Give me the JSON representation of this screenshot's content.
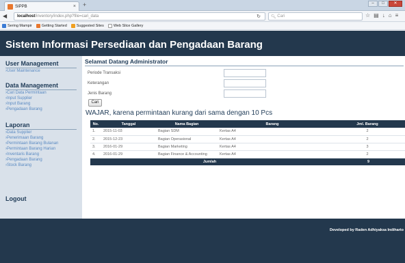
{
  "browser": {
    "tab_title": "SIPPB",
    "tab_close": "×",
    "new_tab": "+",
    "win_min": "–",
    "win_max": "□",
    "win_close": "✕",
    "url_host": "localhost",
    "url_path": "/inventory/index.php?file=cari_data",
    "search_placeholder": "Cari",
    "bookmarks": [
      {
        "label": "Sering Mampir",
        "color": "#3a7bd5"
      },
      {
        "label": "Getting Started",
        "color": "#e8772e"
      },
      {
        "label": "Suggested Sites",
        "color": "#f0a020"
      },
      {
        "label": "Web Slice Gallery",
        "color": "#ffffff"
      }
    ]
  },
  "header": {
    "title": "Sistem Informasi Persediaan dan Pengadaan Barang"
  },
  "sidebar": {
    "user_management": {
      "heading": "User Management",
      "links": [
        "User Maintenance"
      ]
    },
    "data_management": {
      "heading": "Data Management",
      "links": [
        "Cari Data Permintaan",
        "Input Supplier",
        "Input Barang",
        "Pengadaan Barang"
      ]
    },
    "laporan": {
      "heading": "Laporan",
      "links": [
        "Data Supplier",
        "Penerimaan Barang",
        "Permintaan Barang Bulanan",
        "Permintaan Barang Harian",
        "Inventaris Barang",
        "Pengadaan Barang",
        "Stock Barang"
      ]
    },
    "logout": "Logout"
  },
  "main": {
    "welcome": "Selamat Datang Administrator",
    "form": {
      "periode_label": "Periode Transaksi",
      "keterangan_label": "Keterangan",
      "jenis_label": "Jenis Barang",
      "periode_value": "",
      "keterangan_value": "",
      "jenis_value": "",
      "button": "Cari"
    },
    "notice": "WAJAR, karena permintaan kurang dari sama dengan 10 Pcs",
    "table": {
      "headers": [
        "No.",
        "Tanggal",
        "Nama Bagian",
        "Barang",
        "Jml. Barang"
      ],
      "rows": [
        [
          "1.",
          "2015-11-03",
          "Bagian SDM",
          "Kertas A4",
          "2"
        ],
        [
          "2.",
          "2015-12-23",
          "Bagian Operasional",
          "Kertas A4",
          "2"
        ],
        [
          "3.",
          "2016-01-29",
          "Bagian Marketing",
          "Kertas A4",
          "3"
        ],
        [
          "4.",
          "2016-01-29",
          "Bagian Finance & Accounting",
          "Kertas A4",
          "2"
        ]
      ],
      "footer_label": "Jumlah",
      "footer_total": "9"
    }
  },
  "footer": {
    "text": "Developed by Raden Adhiyaksa Indiharto"
  }
}
